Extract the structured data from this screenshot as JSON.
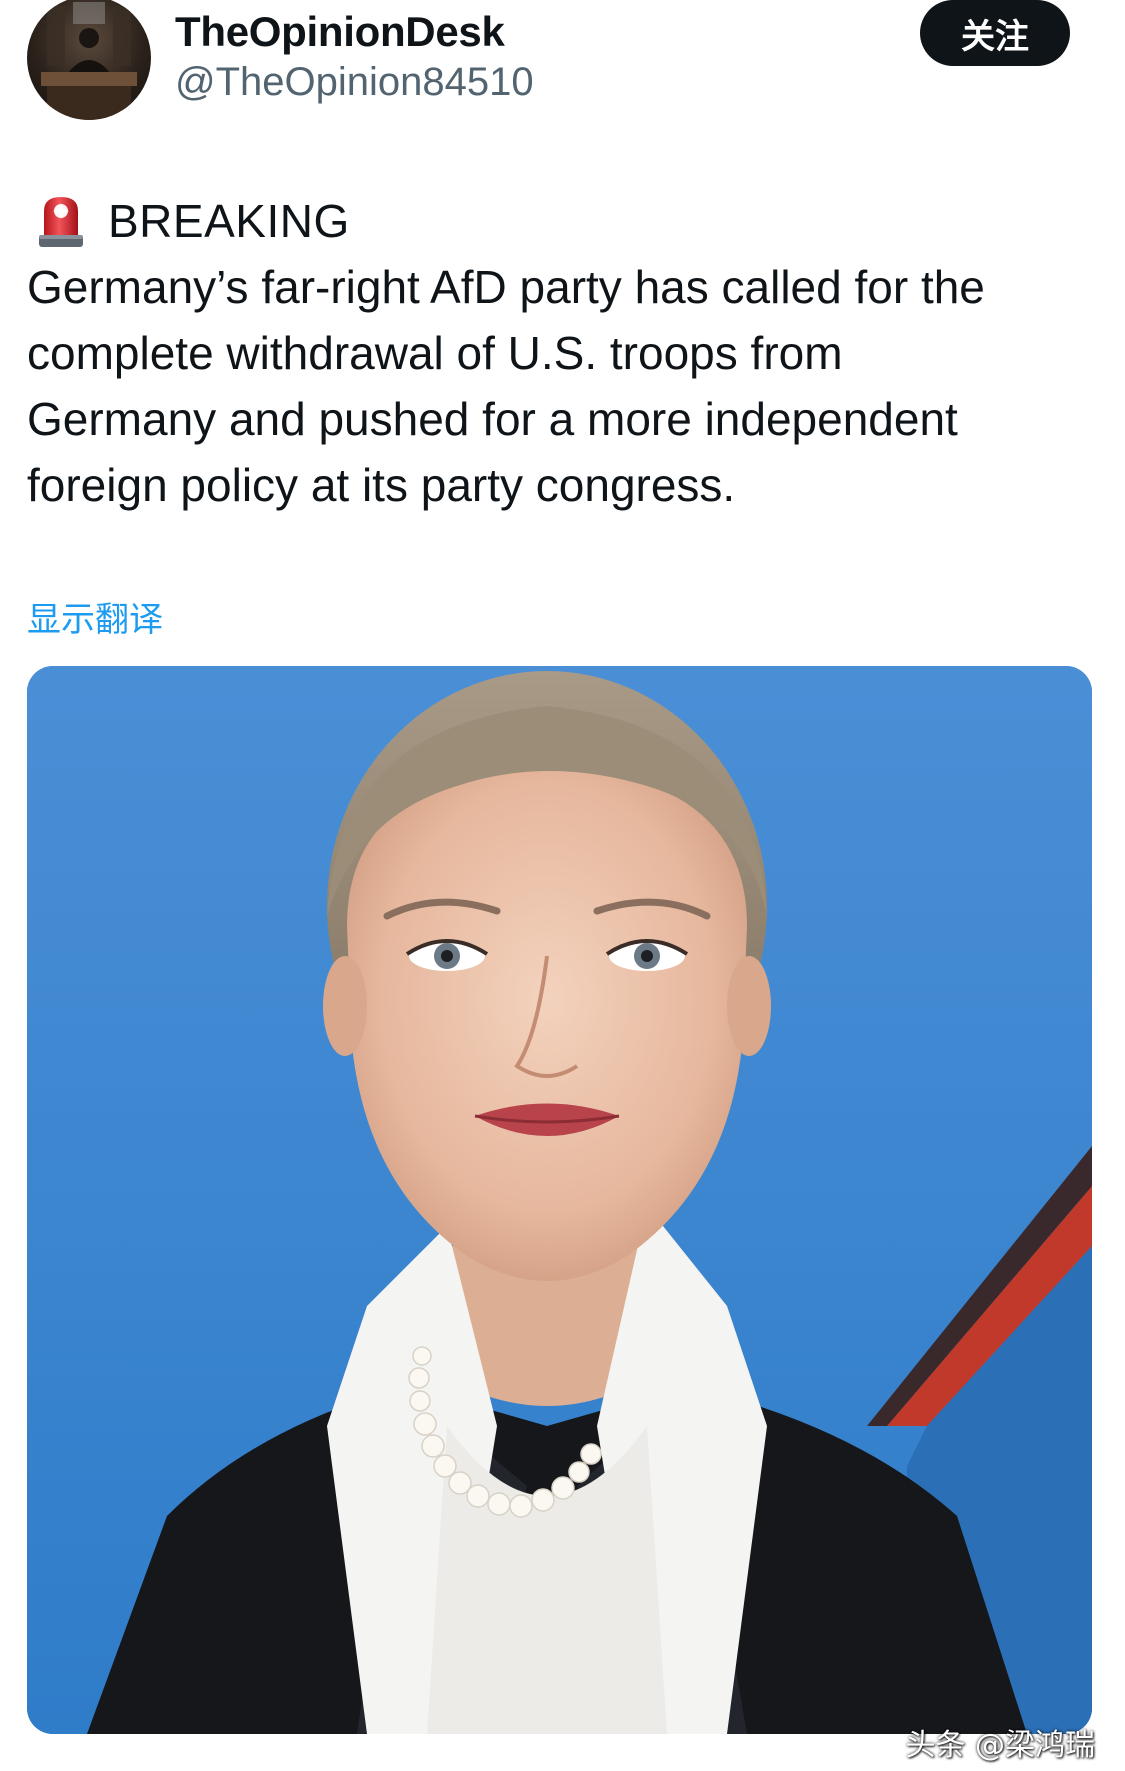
{
  "author": {
    "display_name": "TheOpinionDesk",
    "handle": "@TheOpinion84510",
    "follow_label": "关注"
  },
  "tweet": {
    "icon": "police-siren-icon",
    "breaking_label": "BREAKING",
    "body": "Germany’s far-right AfD party has called for the\ncomplete withdrawal of U.S. troops from\nGermany and pushed for a more independent\nforeign policy at its party congress.",
    "translate_label": "显示翻译"
  },
  "media": {
    "background_color": "#3d85cf",
    "accent_stripe_color": "#c0392b"
  },
  "watermark": {
    "text": "头条 @梁鸿瑞"
  },
  "colors": {
    "text": "#0f1419",
    "secondary_text": "#536471",
    "link": "#1d9bf0",
    "follow_button_bg": "#0f1419"
  }
}
